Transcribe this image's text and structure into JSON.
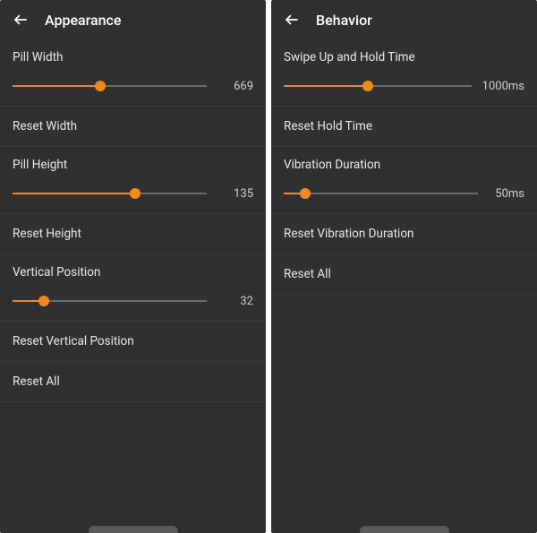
{
  "accent": "#f08a1c",
  "panels": [
    {
      "id": "appearance",
      "title": "Appearance",
      "items": [
        {
          "type": "slider",
          "key": "pill_width",
          "label": "Pill Width",
          "value": "669",
          "pct": 45
        },
        {
          "type": "tap",
          "key": "reset_width",
          "label": "Reset Width"
        },
        {
          "type": "slider",
          "key": "pill_height",
          "label": "Pill Height",
          "value": "135",
          "pct": 63
        },
        {
          "type": "tap",
          "key": "reset_height",
          "label": "Reset Height"
        },
        {
          "type": "slider",
          "key": "vertical_position",
          "label": "Vertical Position",
          "value": "32",
          "pct": 16
        },
        {
          "type": "tap",
          "key": "reset_vertical_position",
          "label": "Reset Vertical Position"
        },
        {
          "type": "tap",
          "key": "reset_all_appearance",
          "label": "Reset All"
        }
      ]
    },
    {
      "id": "behavior",
      "title": "Behavior",
      "items": [
        {
          "type": "slider",
          "key": "swipe_hold_time",
          "label": "Swipe Up and Hold Time",
          "value": "1000ms",
          "pct": 45
        },
        {
          "type": "tap",
          "key": "reset_hold_time",
          "label": "Reset Hold Time"
        },
        {
          "type": "slider",
          "key": "vibration_duration",
          "label": "Vibration Duration",
          "value": "50ms",
          "pct": 11
        },
        {
          "type": "tap",
          "key": "reset_vibration_duration",
          "label": "Reset Vibration Duration"
        },
        {
          "type": "tap",
          "key": "reset_all_behavior",
          "label": "Reset All"
        }
      ]
    }
  ]
}
